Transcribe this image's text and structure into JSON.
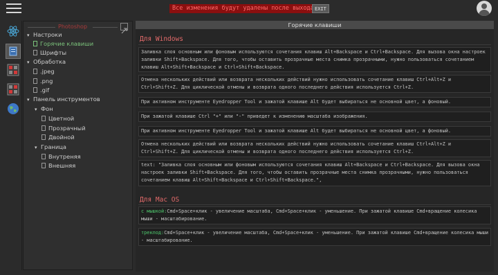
{
  "topbar": {
    "menu_icon": "hamburger-menu-icon",
    "warning": "Все изменения будут удалены после выхода!",
    "exit_label": "EXIT",
    "avatar_icon": "user-avatar-icon"
  },
  "iconbar": {
    "icons": [
      "atom-icon",
      "layout-panel-icon",
      "grid-red-icon",
      "grid-red-icon-2",
      "globe-icon"
    ]
  },
  "tree": {
    "title": "Photoshop",
    "expand_icon": "expand-icon",
    "items": [
      {
        "label": "Настроки",
        "caret": "▾"
      },
      {
        "label": "Горячие клавиши"
      },
      {
        "label": "Шрифты"
      },
      {
        "label": "Обработка",
        "caret": "▾"
      },
      {
        "label": ".jpeg"
      },
      {
        "label": ".png"
      },
      {
        "label": ".gif"
      },
      {
        "label": "Панель инструментов",
        "caret": "▾"
      },
      {
        "label": "Фон",
        "caret": "▾"
      },
      {
        "label": "Цветной"
      },
      {
        "label": "Прозрачный"
      },
      {
        "label": "Двойной"
      },
      {
        "label": "Граница",
        "caret": "▾"
      },
      {
        "label": "Внутреняя"
      },
      {
        "label": "Внешняя"
      }
    ]
  },
  "main": {
    "header": "Горячие клавиши",
    "windows_title": "Для Windows",
    "windows_cards": [
      {
        "text": "Заливка слоя основным или фоновым используются сочетания клавиш Alt+Backspace и Ctrl+Backspace. Для вызова окна настроек заливки Shift+Backspace. Для того, чтобы оставить прозрачные места снимка прозрачными, нужно пользоваться сочетанием клавиш Alt+Shift+Backspace и Ctrl+Shift+Backspace."
      },
      {
        "text": "Отмена нескольких действий или возврата нескольких действий нужно использовать сочетание клавиш Ctrl+Alt+Z и Ctrl+Shift+Z. Для циклической отмены и возврата одного последнего действия используется Ctrl+Z."
      },
      {
        "text": "При активном инструменте Eyedropper Tool и зажатой клавише Alt будет выбираться не основной цвет, а фоновый."
      },
      {
        "text": "При зажатой клавише Ctrl \"+\" или \"-\" приведет к изменению масштаба изображения."
      },
      {
        "text": "При активном инструменте Eyedropper Tool и зажатой клавише Alt будет выбираться не основной цвет, а фоновый."
      },
      {
        "text": "Отмена нескольких действий или возврата нескольких действий нужно использовать сочетание клавиш Ctrl+Alt+Z и Ctrl+Shift+Z. Для циклической отмены и возврата одного последнего действия используется Ctrl+Z."
      },
      {
        "text": "text: \"Заливка слоя основным или фоновым используются сочетания клавиш Alt+Backspace и Ctrl+Backspace. Для вызова окна настроек заливки Shift+Backspace. Для того, чтобы оставить прозрачные места снимка прозрачными, нужно пользоваться сочетанием клавиш Alt+Shift+Backspace и Ctrl+Shift+Backspace.\","
      }
    ],
    "mac_title": "Для Mac OS",
    "mac_cards": [
      {
        "lead": "с мышкой:",
        "text": "Cmd+Space+клик - увеличение масштаба, Cmd+Space+клик - уменьшение. При зажатой клавише Cmd+вращение колесика мыши - масштабирование."
      },
      {
        "lead": "трекпод:",
        "text": "Cmd+Space+клик - увеличение масштаба, Cmd+Space+клик - уменьшение. При зажатой клавише Cmd+вращение колесика мыши - масштабирование."
      }
    ]
  }
}
